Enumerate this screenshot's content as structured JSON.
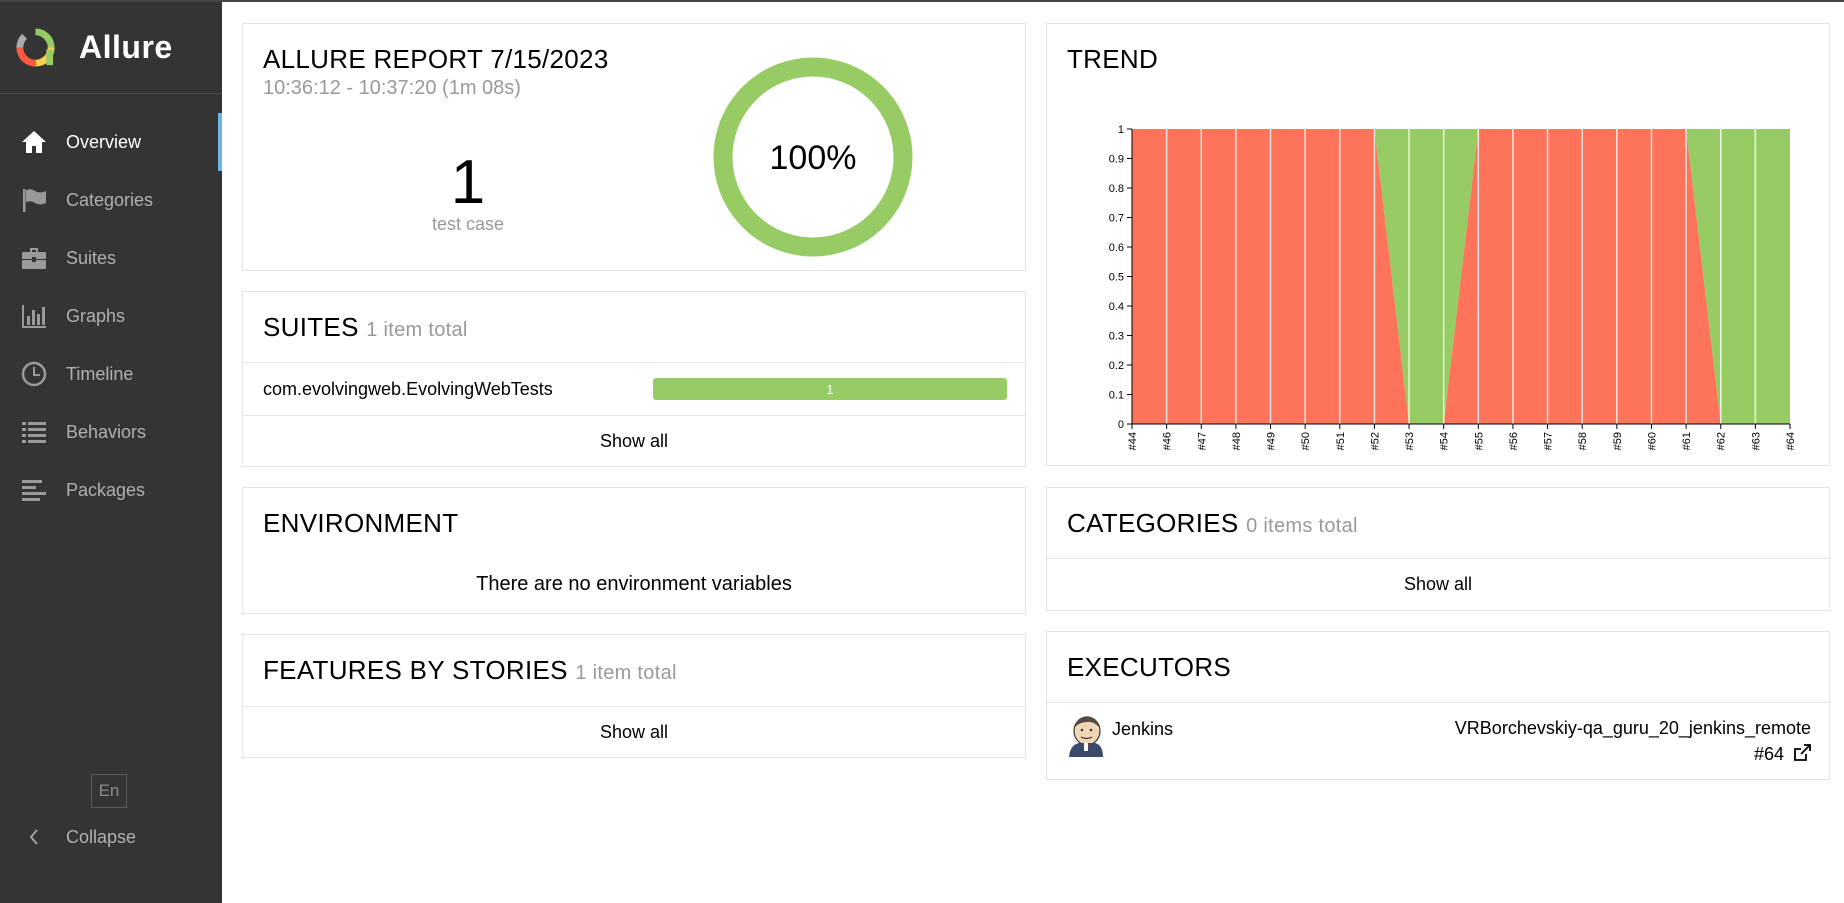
{
  "app": {
    "name": "Allure"
  },
  "sidebar": {
    "items": [
      {
        "label": "Overview",
        "icon": "home-icon",
        "active": true
      },
      {
        "label": "Categories",
        "icon": "flag-icon",
        "active": false
      },
      {
        "label": "Suites",
        "icon": "briefcase-icon",
        "active": false
      },
      {
        "label": "Graphs",
        "icon": "bar-chart-icon",
        "active": false
      },
      {
        "label": "Timeline",
        "icon": "clock-icon",
        "active": false
      },
      {
        "label": "Behaviors",
        "icon": "list-icon",
        "active": false
      },
      {
        "label": "Packages",
        "icon": "align-left-icon",
        "active": false
      }
    ],
    "language": "En",
    "collapse_label": "Collapse"
  },
  "summary": {
    "title": "ALLURE REPORT 7/15/2023",
    "time": "10:36:12 - 10:37:20 (1m 08s)",
    "count": "1",
    "count_label": "test case",
    "percent": "100%",
    "passed_fraction": 1.0,
    "colors": {
      "passed": "#97cc64"
    }
  },
  "suites": {
    "title": "SUITES",
    "subtitle": "1 item total",
    "rows": [
      {
        "name": "com.evolvingweb.EvolvingWebTests",
        "count": "1"
      }
    ],
    "show_all": "Show all"
  },
  "environment": {
    "title": "ENVIRONMENT",
    "empty_text": "There are no environment variables"
  },
  "features": {
    "title": "FEATURES BY STORIES",
    "subtitle": "1 item total",
    "show_all": "Show all"
  },
  "trend": {
    "title": "TREND"
  },
  "categories": {
    "title": "CATEGORIES",
    "subtitle": "0 items total",
    "show_all": "Show all"
  },
  "executors": {
    "title": "EXECUTORS",
    "name": "Jenkins",
    "build_name": "VRBorchevskiy-qa_guru_20_jenkins_remote",
    "build_number": "#64",
    "avatar_icon": "jenkins-avatar-icon",
    "link_icon": "external-link-icon"
  },
  "chart_data": {
    "type": "area",
    "title": "TREND",
    "x": [
      "#44",
      "#46",
      "#47",
      "#48",
      "#49",
      "#50",
      "#51",
      "#52",
      "#53",
      "#54",
      "#55",
      "#56",
      "#57",
      "#58",
      "#59",
      "#60",
      "#61",
      "#62",
      "#63",
      "#64"
    ],
    "series": [
      {
        "status": "failed",
        "color": "#fd745b",
        "values": [
          1,
          1,
          1,
          1,
          1,
          1,
          1,
          1,
          0,
          0,
          1,
          1,
          1,
          1,
          1,
          1,
          1,
          0,
          0,
          0
        ]
      },
      {
        "status": "passed",
        "color": "#97cc64",
        "values": [
          0,
          0,
          0,
          0,
          0,
          0,
          0,
          0,
          1,
          1,
          0,
          0,
          0,
          0,
          0,
          0,
          0,
          1,
          1,
          1
        ]
      }
    ],
    "ylim": [
      0,
      1
    ],
    "yticks": [
      "0",
      "0.1",
      "0.2",
      "0.3",
      "0.4",
      "0.5",
      "0.6",
      "0.7",
      "0.8",
      "0.9",
      "1"
    ],
    "stacked": true,
    "grid": false
  }
}
